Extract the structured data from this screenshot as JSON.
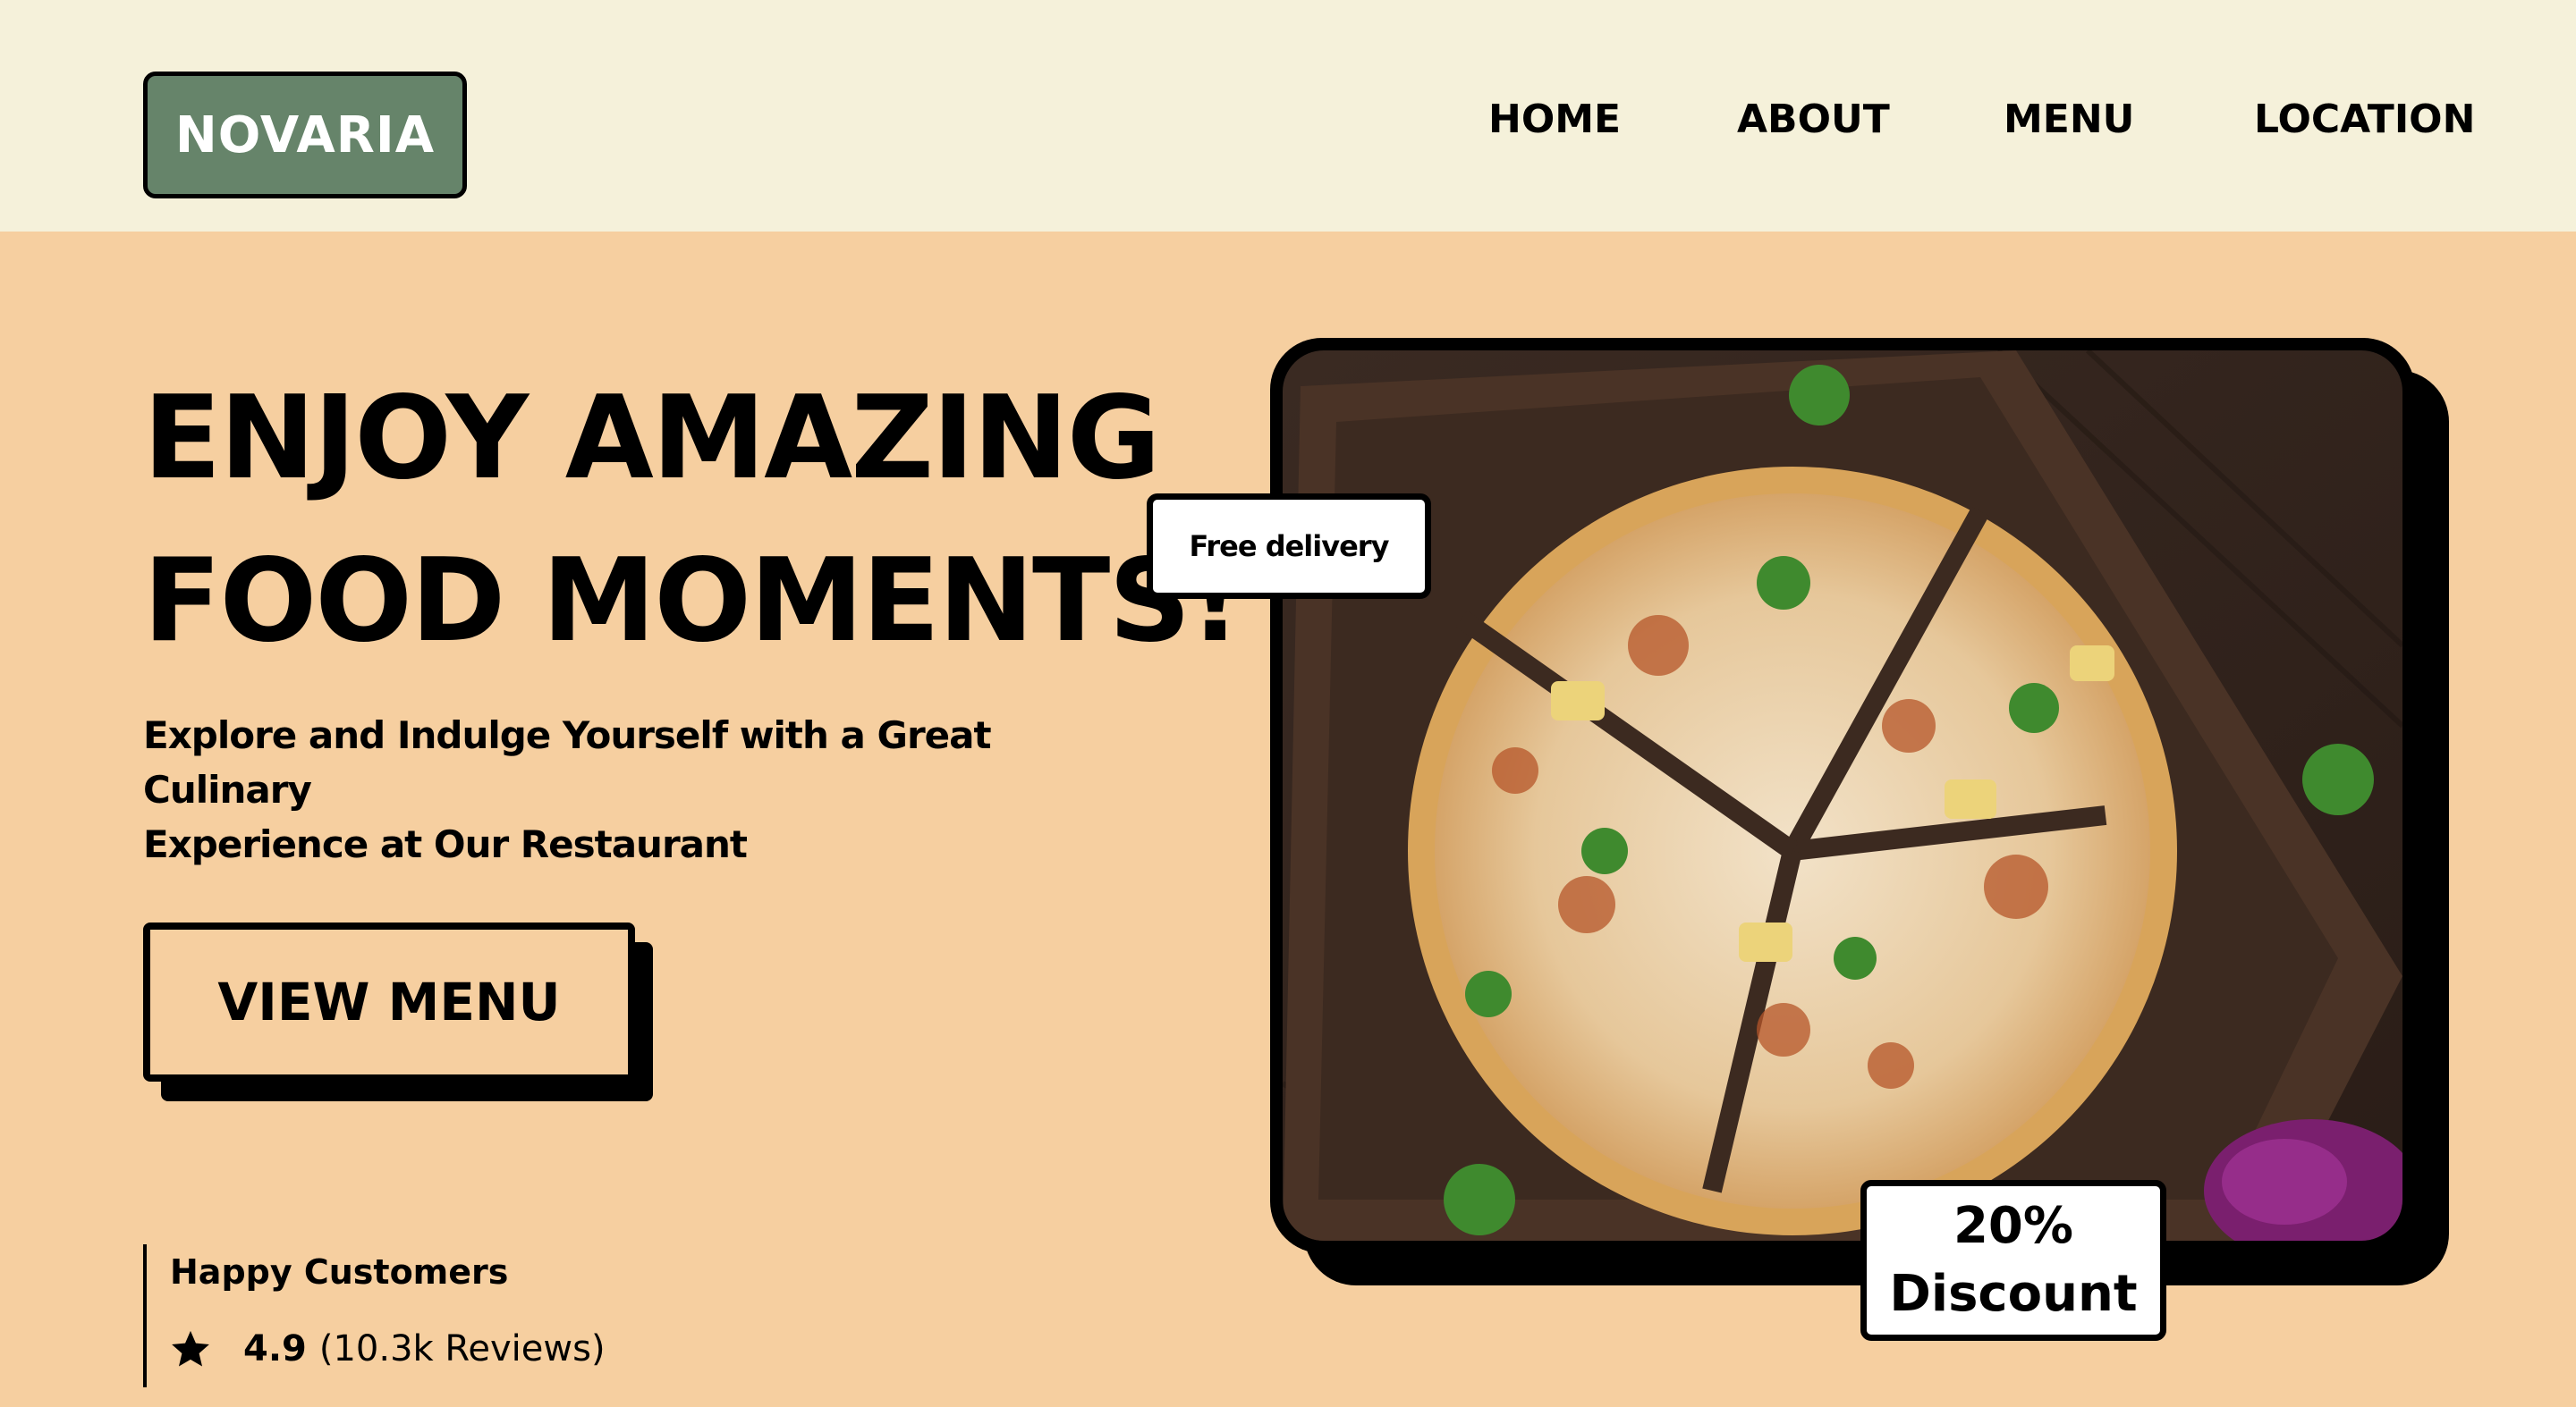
{
  "header": {
    "logo": "NOVARIA",
    "nav": [
      "HOME",
      "ABOUT",
      "MENU",
      "LOCATION"
    ]
  },
  "hero": {
    "title_line1": "ENJOY AMAZING",
    "title_line2": "FOOD MOMENTS!",
    "subtitle_line1": "Explore and Indulge Yourself with a Great Culinary",
    "subtitle_line2": "Experience at Our Restaurant",
    "cta_label": "VIEW MENU"
  },
  "rating": {
    "label": "Happy Customers",
    "score": "4.9",
    "reviews": "(10.3k Reviews)",
    "icon": "star-icon"
  },
  "card": {
    "image": "pizza-photo",
    "delivery_tag": "Free delivery",
    "discount_line1": "20%",
    "discount_line2": "Discount"
  },
  "colors": {
    "header_bg": "#f5f1da",
    "page_bg": "#f6cfa0",
    "logo_bg": "#66846a",
    "text": "#000000"
  }
}
